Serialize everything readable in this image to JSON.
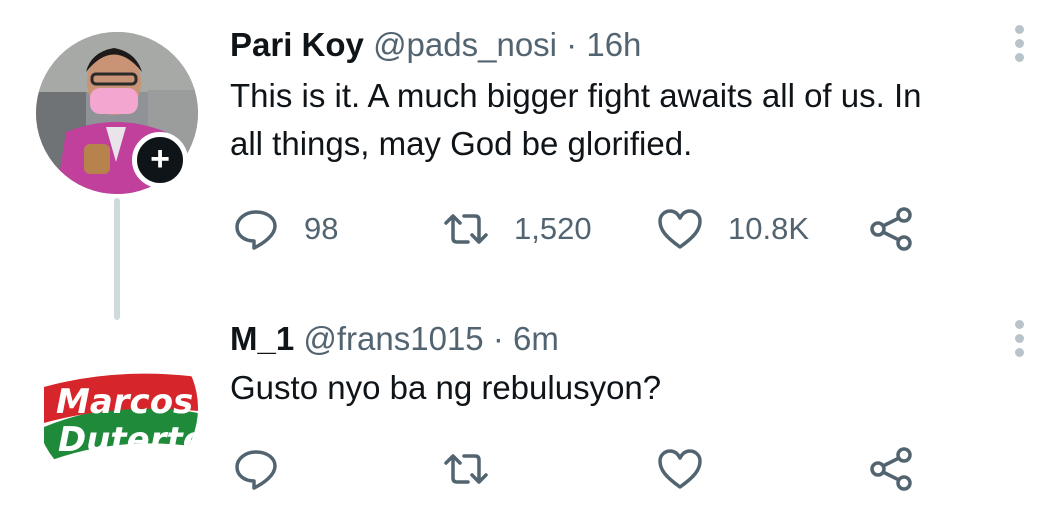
{
  "tweets": [
    {
      "name": "Pari Koy",
      "handle": "@pads_nosi",
      "separator": " · ",
      "time": "16h",
      "text": "This is it. A much bigger fight awaits all of us. In\nall things, may God be glorified.",
      "follow_glyph": "+",
      "replies": "98",
      "retweets": "1,520",
      "likes": "10.8K",
      "avatar_colors": {
        "bg": "#8a8f93",
        "shirt": "#c0409c",
        "mask": "#f2a6d0"
      }
    },
    {
      "name": "M_1",
      "handle": "@frans1015",
      "separator": " · ",
      "time": "6m",
      "text": "Gusto nyo ba ng rebulusyon?",
      "replies": "",
      "retweets": "",
      "likes": "",
      "avatar_logo_line1": "Marcos",
      "avatar_logo_line2": "Duterte",
      "avatar_colors": {
        "red": "#d6262b",
        "green": "#1f8a3a"
      }
    }
  ],
  "icons": [
    "reply-icon",
    "retweet-icon",
    "like-icon",
    "share-icon",
    "more-icon"
  ],
  "colors": {
    "text": "#0f1419",
    "muted": "#536471",
    "icon": "#536471",
    "thread_line": "#cfd9de"
  }
}
